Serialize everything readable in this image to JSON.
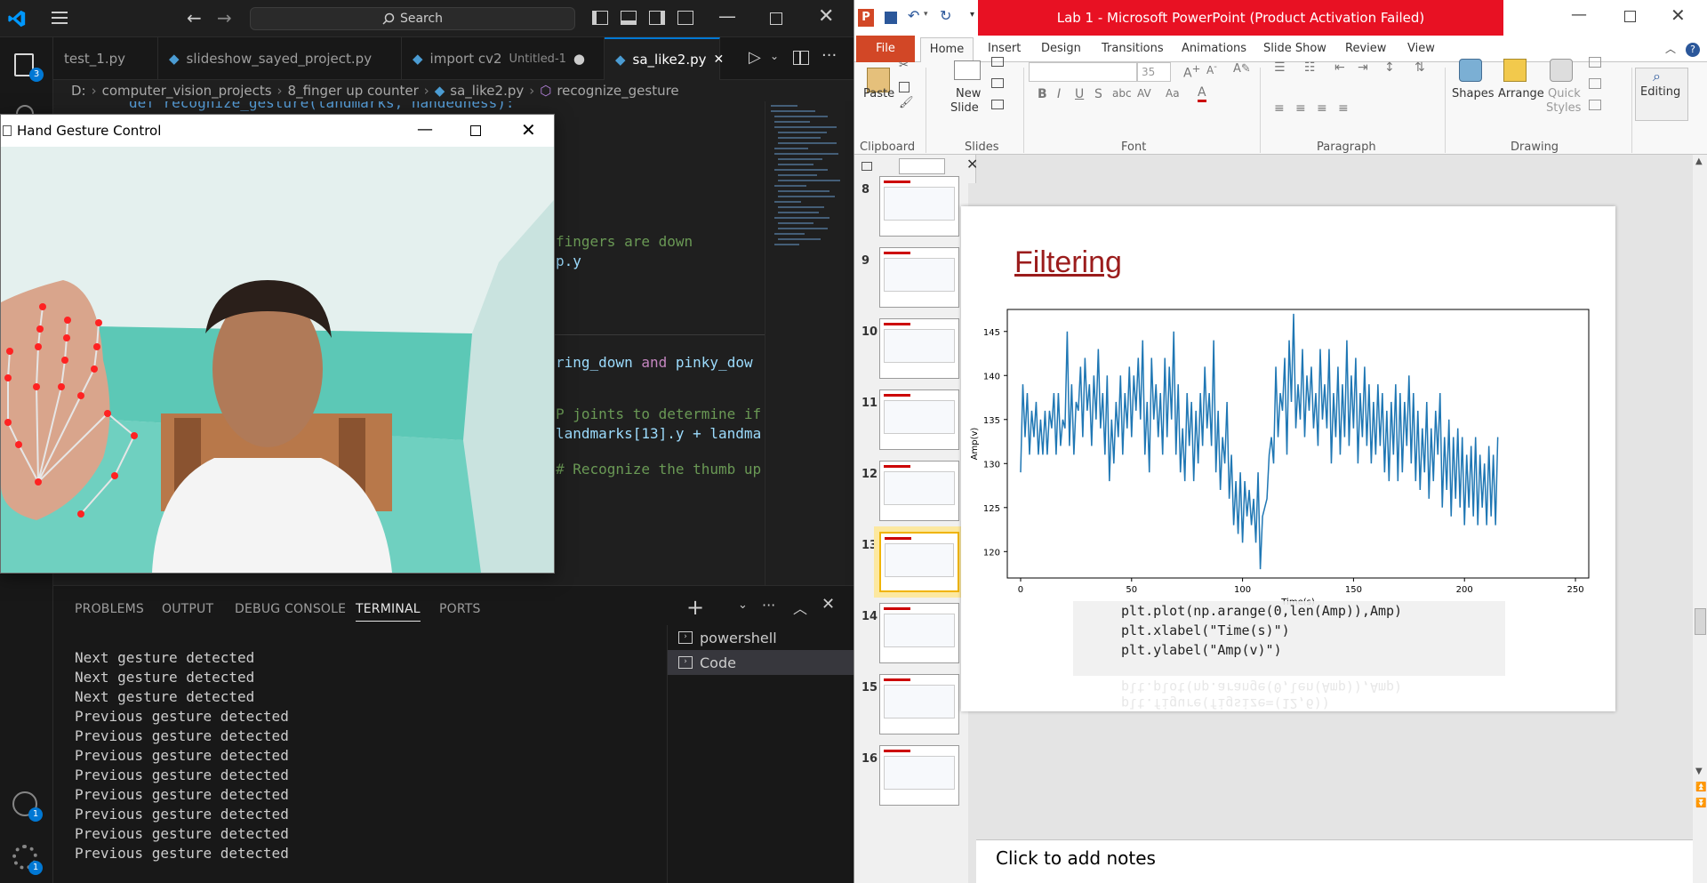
{
  "vscode": {
    "search": "Search",
    "badge_accounts": "1",
    "badge_settings": "1",
    "badge_explorer": "3",
    "tabs": [
      {
        "label": "test_1.py"
      },
      {
        "label": "slideshow_sayed_project.py"
      },
      {
        "label": "import cv2",
        "extra": "Untitled-1"
      },
      {
        "label": "sa_like2.py"
      }
    ],
    "breadcrumb": [
      "D:",
      "computer_vision_projects",
      "8_finger up counter",
      "sa_like2.py",
      "recognize_gesture"
    ],
    "code_lines": {
      "line_top": "def recognize_gesture(landmarks, handedness):",
      "l1": "fingers are down",
      "l2": "p.y",
      "l3a": "ring_down",
      "l3b": "and",
      "l3c": "pinky_dow",
      "l4": "P joints to determine if",
      "l5a": "landmarks[13]",
      "l5b": ".y + landma",
      "l6": "# Recognize the thumb up gesture and the \"liked\" gesture"
    },
    "panel_tabs": [
      "PROBLEMS",
      "OUTPUT",
      "DEBUG CONSOLE",
      "TERMINAL",
      "PORTS"
    ],
    "terminal_output": [
      "Next gesture detected",
      "Next gesture detected",
      "Next gesture detected",
      "Previous gesture detected",
      "Previous gesture detected",
      "Previous gesture detected",
      "Previous gesture detected",
      "Previous gesture detected",
      "Previous gesture detected",
      "Previous gesture detected",
      "Previous gesture detected"
    ],
    "terminals": [
      "powershell",
      "Code"
    ]
  },
  "hand_window": {
    "title": "Hand Gesture Control"
  },
  "ppt": {
    "title": "Lab 1  -  Microsoft PowerPoint (Product Activation Failed)",
    "tabs": [
      "File",
      "Home",
      "Insert",
      "Design",
      "Transitions",
      "Animations",
      "Slide Show",
      "Review",
      "View"
    ],
    "ribbon": {
      "paste": "Paste",
      "new_slide_line1": "New",
      "new_slide_line2": "Slide",
      "font_size": "35",
      "shapes": "Shapes",
      "arrange": "Arrange",
      "quick_styles_1": "Quick",
      "quick_styles_2": "Styles",
      "editing": "Editing",
      "groups": [
        "Clipboard",
        "Slides",
        "Font",
        "Paragraph",
        "Drawing"
      ]
    },
    "slide_numbers": [
      "8",
      "9",
      "10",
      "11",
      "12",
      "13",
      "14",
      "15",
      "16"
    ],
    "slide": {
      "title": "Filtering",
      "code": [
        "plt.plot(np.arange(0,len(Amp)),Amp)",
        "plt.xlabel(\"Time(s)\")",
        "plt.ylabel(\"Amp(v)\")"
      ],
      "reflect_code": [
        "plt.ylabel(\"Amp(v)\")",
        "plt.xlabel(\"Time(s)\")",
        "plt.plot(np.arange(0,len(Amp)),Amp)",
        "plt.figure(figsize=(12,6))"
      ]
    },
    "notes": "Click to add notes"
  },
  "chart_data": {
    "type": "line",
    "xlabel": "Time(s)",
    "ylabel": "Amp(v)",
    "xlim": [
      -6,
      256
    ],
    "ylim": [
      117,
      147.5
    ],
    "xticks": [
      0,
      50,
      100,
      150,
      200,
      250
    ],
    "yticks": [
      120,
      125,
      130,
      135,
      140,
      145
    ],
    "series": [
      {
        "color": "#1f77b4",
        "values": [
          129,
          139,
          133,
          138,
          131,
          136,
          133,
          137,
          131,
          135,
          131,
          136,
          131,
          136,
          134,
          138,
          131,
          138,
          132,
          135,
          134,
          145,
          132,
          139,
          131,
          137,
          136,
          141,
          133,
          142,
          136,
          139,
          132,
          140,
          135,
          143,
          134,
          138,
          131,
          140,
          128,
          135,
          130,
          137,
          133,
          140,
          131,
          138,
          134,
          141,
          133,
          140,
          136,
          142,
          135,
          144,
          131,
          137,
          129,
          142,
          135,
          139,
          133,
          138,
          131,
          142,
          133,
          141,
          135,
          145,
          131,
          139,
          129,
          134,
          128,
          138,
          132,
          137,
          128,
          136,
          130,
          138,
          132,
          141,
          134,
          138,
          132,
          144,
          129,
          136,
          127,
          133,
          130,
          137,
          126,
          131,
          123,
          128,
          122,
          129,
          121,
          128,
          124,
          127,
          123,
          126,
          121,
          129,
          118,
          124,
          125,
          126,
          131,
          133,
          130,
          141,
          133,
          138,
          136,
          142,
          131,
          144,
          137,
          147,
          134,
          139,
          135,
          143,
          133,
          140,
          136,
          141,
          134,
          138,
          132,
          143,
          135,
          139,
          134,
          143,
          130,
          138,
          133,
          141,
          131,
          139,
          133,
          144,
          132,
          140,
          134,
          142,
          130,
          138,
          133,
          141,
          132,
          139,
          130,
          137,
          131,
          139,
          132,
          138,
          129,
          136,
          128,
          137,
          131,
          139,
          128,
          138,
          129,
          137,
          132,
          140,
          130,
          138,
          128,
          136,
          127,
          134,
          129,
          137,
          126,
          134,
          128,
          136,
          131,
          138,
          125,
          133,
          127,
          135,
          124,
          133,
          126,
          134,
          125,
          133,
          123,
          131,
          125,
          132,
          124,
          133,
          123,
          131,
          125,
          130,
          123,
          132,
          124,
          131,
          123,
          133
        ]
      }
    ]
  }
}
